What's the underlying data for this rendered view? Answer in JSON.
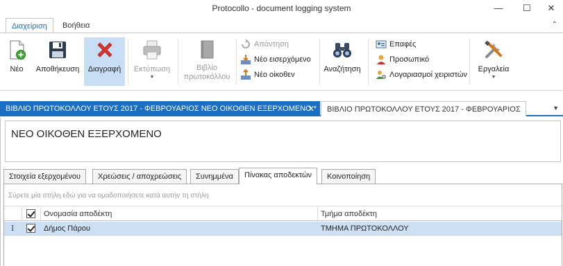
{
  "window": {
    "title": "Protocollo - document logging system",
    "buttons": {
      "minimize": "—",
      "maximize": "☐",
      "close": "✕"
    }
  },
  "ribbon_tabs": [
    {
      "label": "Διαχείριση",
      "active": true
    },
    {
      "label": "Βοήθεια",
      "active": false
    }
  ],
  "ribbon": {
    "new": "Νέο",
    "save": "Αποθήκευση",
    "delete": "Διαγραφή",
    "print": "Εκτύπωση",
    "book": "Βιβλίο πρωτοκόλλου",
    "reply": "Απάντηση",
    "new_incoming": "Νέο εισερχόμενο",
    "new_outgoing": "Νέο οίκοθεν",
    "search": "Αναζήτηση",
    "contacts": "Επαφές",
    "staff": "Προσωπικό",
    "user_accounts": "Λογαριασμοί χειριστών",
    "tools": "Εργαλεία"
  },
  "doc_tabs": [
    {
      "label": "ΒΙΒΛΙΟ ΠΡΩΤΟΚΟΛΛΟΥ ΕΤΟΥΣ 2017 - ΦΕΒΡΟΥΑΡΙΟΣ  ΝΕΟ ΟΙΚΟΘΕΝ ΕΞΕΡΧΟΜΕΝΟ *",
      "active": true,
      "close": "✕"
    },
    {
      "label": "ΒΙΒΛΙΟ ΠΡΩΤΟΚΟΛΛΟΥ ΕΤΟΥΣ 2017 - ΦΕΒΡΟΥΑΡΙΟΣ",
      "active": false
    }
  ],
  "form": {
    "title": "ΝΕΟ ΟΙΚΟΘΕΝ ΕΞΕΡΧΟΜΕΝΟ"
  },
  "sub_tabs": [
    {
      "label": "Στοιχεία εξερχομένου",
      "active": false
    },
    {
      "label": "Χρεώσεις  / αποχρεώσεις",
      "active": false
    },
    {
      "label": "Συνημμένα",
      "active": false
    },
    {
      "label": "Πίνακας αποδεκτών",
      "active": true
    },
    {
      "label": "Κοινοποίηση",
      "active": false
    }
  ],
  "grid": {
    "group_hint": "Σύρετε μία στήλη εδώ για να ομαδοποιήσετε κατά αυτήν τη στήλη",
    "columns": [
      "Ονομασία αποδέκτη",
      "Τμήμα αποδέκτη"
    ],
    "rows": [
      {
        "selected": true,
        "checked": true,
        "name": "Δήμος Πάρου",
        "department": "ΤΜΗΜΑ ΠΡΩΤΟΚΟΛΛΟΥ"
      }
    ],
    "row_indicator": "I"
  }
}
